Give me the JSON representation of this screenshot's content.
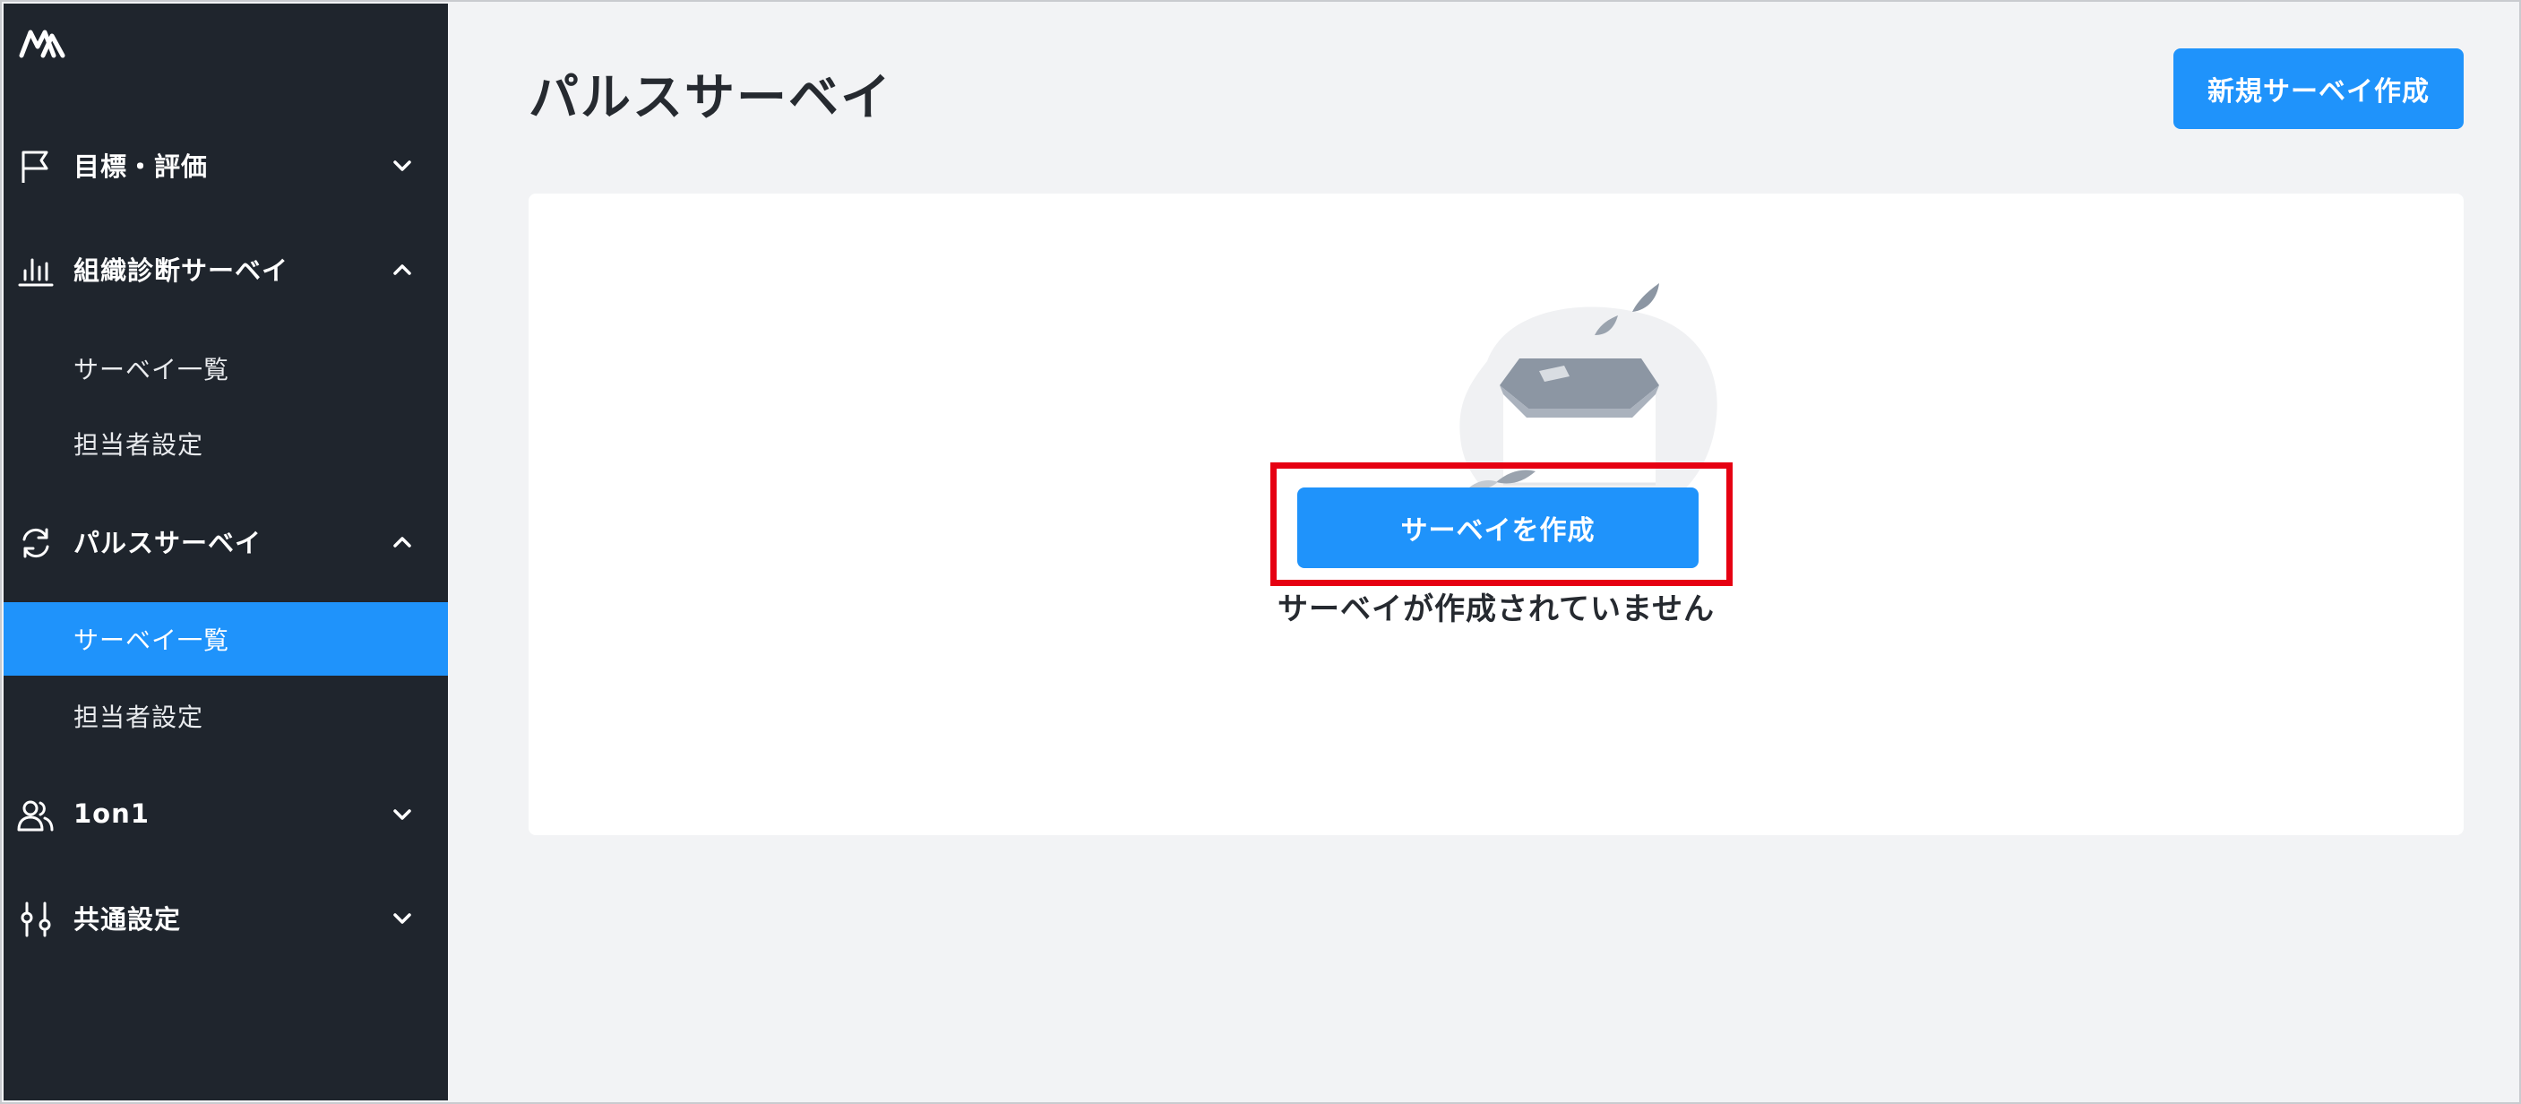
{
  "sidebar": {
    "logo": "logo-icon",
    "sections": {
      "goals": {
        "label": "目標・評価",
        "icon": "flag-icon",
        "expanded": false
      },
      "org_survey": {
        "label": "組織診断サーベイ",
        "icon": "bar-chart-icon",
        "expanded": true,
        "items": [
          "サーベイ一覧",
          "担当者設定"
        ]
      },
      "pulse_survey": {
        "label": "パルスサーベイ",
        "icon": "refresh-icon",
        "expanded": true,
        "items": [
          "サーベイ一覧",
          "担当者設定"
        ],
        "active_item": "サーベイ一覧"
      },
      "one_on_one": {
        "label": "1on1",
        "icon": "users-icon",
        "expanded": false
      },
      "common_settings": {
        "label": "共通設定",
        "icon": "sliders-icon",
        "expanded": false
      }
    }
  },
  "header": {
    "title": "パルスサーベイ",
    "new_button_label": "新規サーベイ作成"
  },
  "empty_state": {
    "illustration": "empty-inbox-icon",
    "message": "サーベイが作成されていません",
    "create_button_label": "サーベイを作成"
  },
  "colors": {
    "sidebar_bg": "#1f252d",
    "accent": "#1f93fb",
    "highlight": "#e60012",
    "page_bg": "#f2f3f5"
  }
}
